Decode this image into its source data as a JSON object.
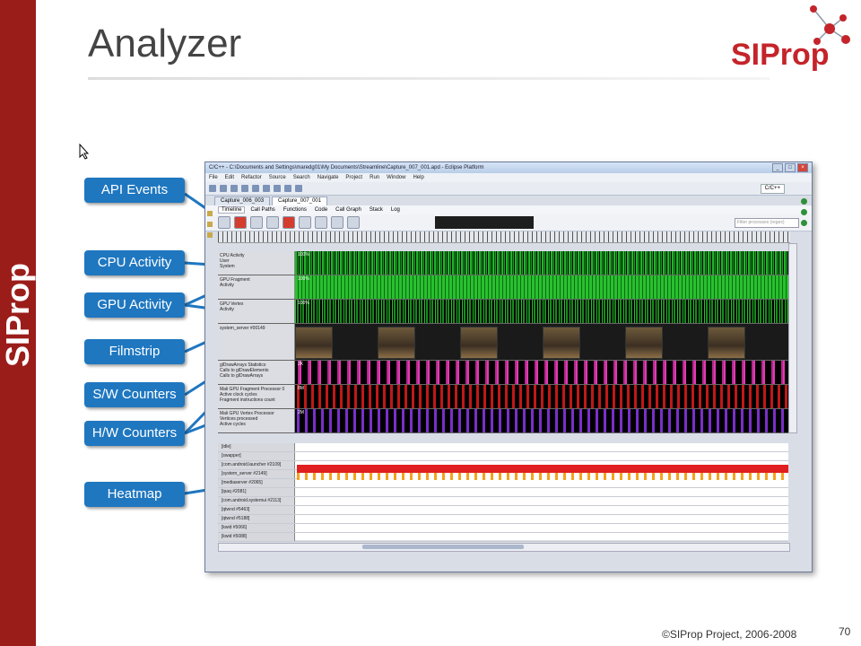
{
  "slide": {
    "title": "Analyzer",
    "sidebar_text": "SIProp",
    "logo_text": "SIProp",
    "footer": "©SIProp Project, 2006-2008",
    "page_number": "70"
  },
  "callouts": [
    {
      "label": "API Events"
    },
    {
      "label": "CPU Activity"
    },
    {
      "label": "GPU Activity"
    },
    {
      "label": "Filmstrip"
    },
    {
      "label": "S/W Counters"
    },
    {
      "label": "H/W Counters"
    },
    {
      "label": "Heatmap"
    }
  ],
  "window": {
    "title": "C/C++ - C:\\Documents and Settings\\maredg01\\My Documents\\Streamline\\Capture_007_001.apd - Eclipse Platform",
    "menu": [
      "File",
      "Edit",
      "Refactor",
      "Source",
      "Search",
      "Navigate",
      "Project",
      "Run",
      "Window",
      "Help"
    ],
    "perspective": "C/C++",
    "editor_tabs": [
      "Capture_006_003",
      "Capture_007_001"
    ],
    "view_tabs": [
      "Timeline",
      "Call Paths",
      "Functions",
      "Code",
      "Call Graph",
      "Stack",
      "Log"
    ],
    "filter_placeholder": "Filter processes (regex)",
    "tooltip": "eglSwapBuffers",
    "rows": [
      {
        "title": "CPU Activity",
        "items": [
          "User",
          "System"
        ],
        "value": "100%"
      },
      {
        "title": "GPU Fragment",
        "items": [
          "Activity"
        ],
        "value": "100%"
      },
      {
        "title": "GPU Vertex",
        "items": [
          "Activity"
        ],
        "value": "100%"
      },
      {
        "title": "system_server #00149",
        "items": [],
        "value": ""
      },
      {
        "title": "glDrawArrays Statistics",
        "items": [
          "Calls to glDrawElements",
          "Calls to glDrawArrays"
        ],
        "value": "2K"
      },
      {
        "title": "Mali GPU Fragment Processor 0",
        "items": [
          "Active clock cycles",
          "Fragment instructions count"
        ],
        "value": "8M"
      },
      {
        "title": "Mali GPU Vertex Processor",
        "items": [
          "Vertices processed",
          "Active cycles"
        ],
        "value": "2M"
      }
    ],
    "process_rows": [
      "[idle]",
      "[swapper]",
      "[com.android.launcher #2109]",
      "[system_server #2149]",
      "[mediaserver #2065]",
      "[ipaq #2081]",
      "[com.android.systemui #2113]",
      "[qtwnd #5463]",
      "[qtwnd #5188]",
      "[kwid #5066]",
      "[kwid #5088]"
    ]
  }
}
